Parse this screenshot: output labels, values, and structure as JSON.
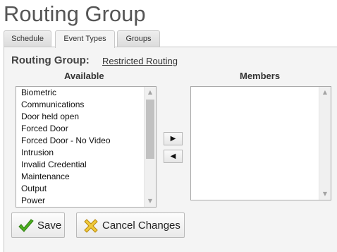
{
  "page": {
    "title": "Routing Group"
  },
  "tabs": [
    {
      "label": "Schedule"
    },
    {
      "label": "Event Types"
    },
    {
      "label": "Groups"
    }
  ],
  "routing_group": {
    "label": "Routing Group:",
    "name": "Restricted Routing"
  },
  "available": {
    "heading": "Available",
    "items": [
      "Biometric",
      "Communications",
      "Door held open",
      "Forced Door",
      "Forced Door - No Video",
      "Intrusion",
      "Invalid Credential",
      "Maintenance",
      "Output",
      "Power"
    ]
  },
  "members": {
    "heading": "Members",
    "items": []
  },
  "move_buttons": {
    "add_glyph": "▶",
    "remove_glyph": "◀"
  },
  "actions": {
    "save_label": "Save",
    "save_icon": "check-icon",
    "cancel_label": "Cancel Changes",
    "cancel_icon": "cancel-x-icon"
  },
  "colors": {
    "title": "#555555",
    "panel_bg": "#f4f4f4",
    "check_green": "#4caf1e",
    "cancel_yellow": "#f0c93a"
  }
}
